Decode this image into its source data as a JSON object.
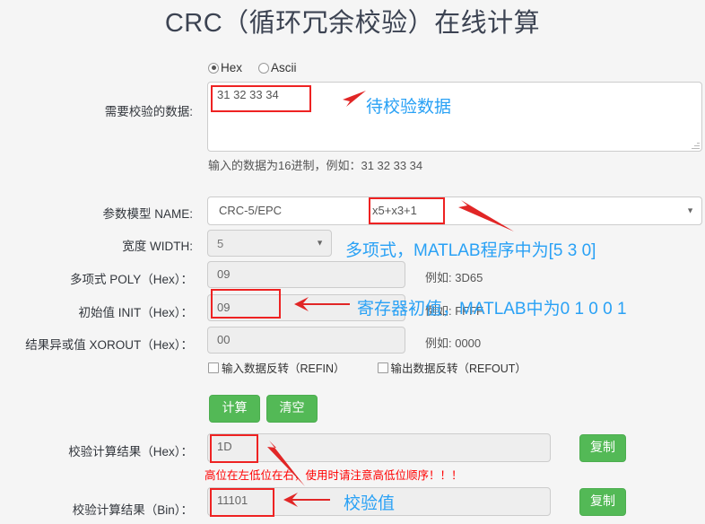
{
  "page": {
    "title": "CRC（循环冗余校验）在线计算",
    "bg_color": "#f5f5f5",
    "accent_green": "#53b956",
    "anno_blue": "#29a1f5",
    "anno_red": "#ff0000"
  },
  "input_mode": {
    "options": [
      {
        "label": "Hex",
        "checked": true
      },
      {
        "label": "Ascii",
        "checked": false
      }
    ]
  },
  "data_field": {
    "label": "需要校验的数据:",
    "value": "31 32 33 34",
    "placeholder": "",
    "hint": "输入的数据为16进制，例如：31 32 33 34",
    "annotation": "待校验数据"
  },
  "model": {
    "label": "参数模型 NAME:",
    "name": "CRC-5/EPC",
    "poly_expr": "x5+x3+1",
    "caret": "▼"
  },
  "width": {
    "label": "宽度 WIDTH:",
    "value": "5",
    "caret": "▼",
    "annotation": "多项式，MATLAB程序中为[5 3 0]"
  },
  "poly": {
    "label": "多项式 POLY（Hex）：",
    "value": "09",
    "hint": "例如: 3D65"
  },
  "init": {
    "label": "初始值 INIT（Hex）：",
    "value": "09",
    "hint": "例如: FFFF",
    "annotation": "寄存器初值，MATLAB中为0 1 0 0 1"
  },
  "xorout": {
    "label": "结果异或值 XOROUT（Hex）：",
    "value": "00",
    "hint": "例如: 0000"
  },
  "flags": [
    {
      "label": "输入数据反转（REFIN）",
      "checked": false
    },
    {
      "label": "输出数据反转（REFOUT）",
      "checked": false
    }
  ],
  "actions": {
    "calc_label": "计算",
    "clear_label": "清空"
  },
  "result_hex": {
    "label": "校验计算结果（Hex）：",
    "value": "1D",
    "copy_label": "复制",
    "warning": "高位在左低位在右，使用时请注意高低位顺序！！！"
  },
  "result_bin": {
    "label": "校验计算结果（Bin）：",
    "value": "11101",
    "copy_label": "复制",
    "annotation": "校验值"
  }
}
